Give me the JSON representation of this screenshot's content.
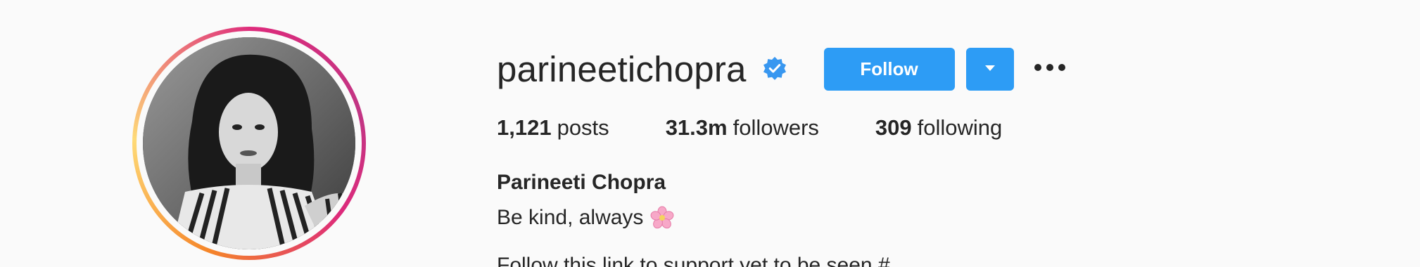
{
  "profile": {
    "username": "parineetichopra",
    "verified": true,
    "follow_label": "Follow",
    "dropdown_icon": "chevron-down-icon",
    "more_icon": "more-options-icon",
    "stats": {
      "posts_count": "1,121",
      "posts_label": "posts",
      "followers_count": "31.3m",
      "followers_label": "followers",
      "following_count": "309",
      "following_label": "following"
    },
    "full_name": "Parineeti Chopra",
    "bio": "Be kind, always",
    "bio_emoji_icon": "cherry-blossom-icon",
    "partial_line": "Follow this link to support yet to be seen #"
  },
  "colors": {
    "accent": "#2d9cf5",
    "verified": "#3897f0",
    "text": "#262626",
    "background": "#fafafa",
    "ring_start": "#f58529",
    "ring_end": "#c13584"
  }
}
